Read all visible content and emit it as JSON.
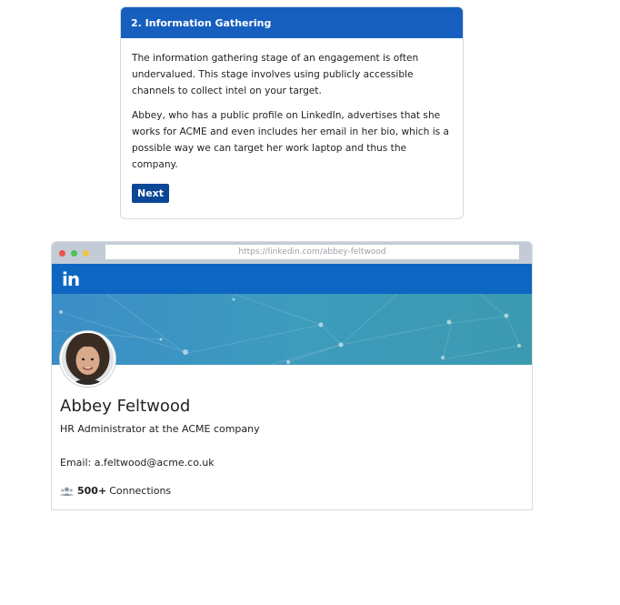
{
  "task": {
    "title": "2. Information Gathering",
    "paragraph1": "The information gathering stage of an engagement is often undervalued. This stage involves using publicly accessible channels to collect intel on your target.",
    "paragraph2": "Abbey, who has a public profile on LinkedIn, advertises that she works for ACME and even includes her email in her bio, which is a possible way we can target her work laptop and thus the company.",
    "next_label": "Next"
  },
  "browser": {
    "url": "https://linkedin.com/abbey-feltwood",
    "brand_logo": "in"
  },
  "profile": {
    "name": "Abbey Feltwood",
    "headline": "HR Administrator at the ACME company",
    "email": "Email: a.feltwood@acme.co.uk",
    "connections_count": "500+",
    "connections_label": "Connections"
  },
  "colors": {
    "task_header": "#165fbf",
    "next_button": "#0b4796",
    "linkedin_blue": "#0d66c2"
  }
}
